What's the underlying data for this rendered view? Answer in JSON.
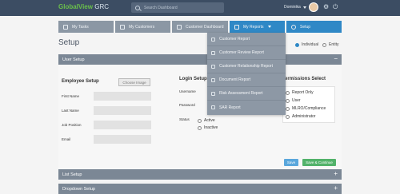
{
  "header": {
    "brand_part1": "GlobalView",
    "brand_part2": "GRC",
    "search_placeholder": "Search Dashboard",
    "user_name": "Dominika"
  },
  "nav": {
    "tabs": [
      {
        "label": "My Tasks"
      },
      {
        "label": "My Customers"
      },
      {
        "label": "Customer Dashboard"
      },
      {
        "label": "My Reports"
      },
      {
        "label": "Setup"
      }
    ],
    "reports_menu": [
      {
        "label": "Customer Report"
      },
      {
        "label": "Customer Review Report"
      },
      {
        "label": "Customer Relationship Report"
      },
      {
        "label": "Document Report"
      },
      {
        "label": "Risk Assessment Report"
      },
      {
        "label": "SAR Report"
      }
    ]
  },
  "page": {
    "title": "Setup",
    "mode_options": [
      {
        "label": "Individual",
        "selected": true
      },
      {
        "label": "Entity",
        "selected": false
      }
    ]
  },
  "sections": {
    "user_setup": "User Setup",
    "list_setup": "List Setup",
    "dropdown_setup": "Dropdown Setup",
    "collapse_symbol": "−",
    "expand_symbol": "+"
  },
  "employee": {
    "heading": "Employee Setup",
    "choose_image": "Choose Image",
    "fields": [
      {
        "label": "First Name",
        "value": ""
      },
      {
        "label": "Last Name",
        "value": ""
      },
      {
        "label": "Job Position",
        "value": ""
      },
      {
        "label": "Email",
        "value": ""
      }
    ]
  },
  "login": {
    "heading": "Login Setup",
    "username_label": "Username",
    "password_label": "Password",
    "status_label": "Status",
    "status_options": [
      "Active",
      "Inactive"
    ]
  },
  "permissions": {
    "heading": "Permissions Select",
    "options": [
      "Report Only",
      "User",
      "MLRO/Compliance",
      "Administrator"
    ]
  },
  "buttons": {
    "save": "Save",
    "save_continue": "Save & Continue"
  },
  "colors": {
    "topbar": "#3c4d63",
    "brand_green": "#6ac04b",
    "active_tab": "#2f88c6",
    "tab_grey": "#8b97a4",
    "save_blue": "#5aa7dc",
    "save_continue_green": "#52b26a"
  }
}
